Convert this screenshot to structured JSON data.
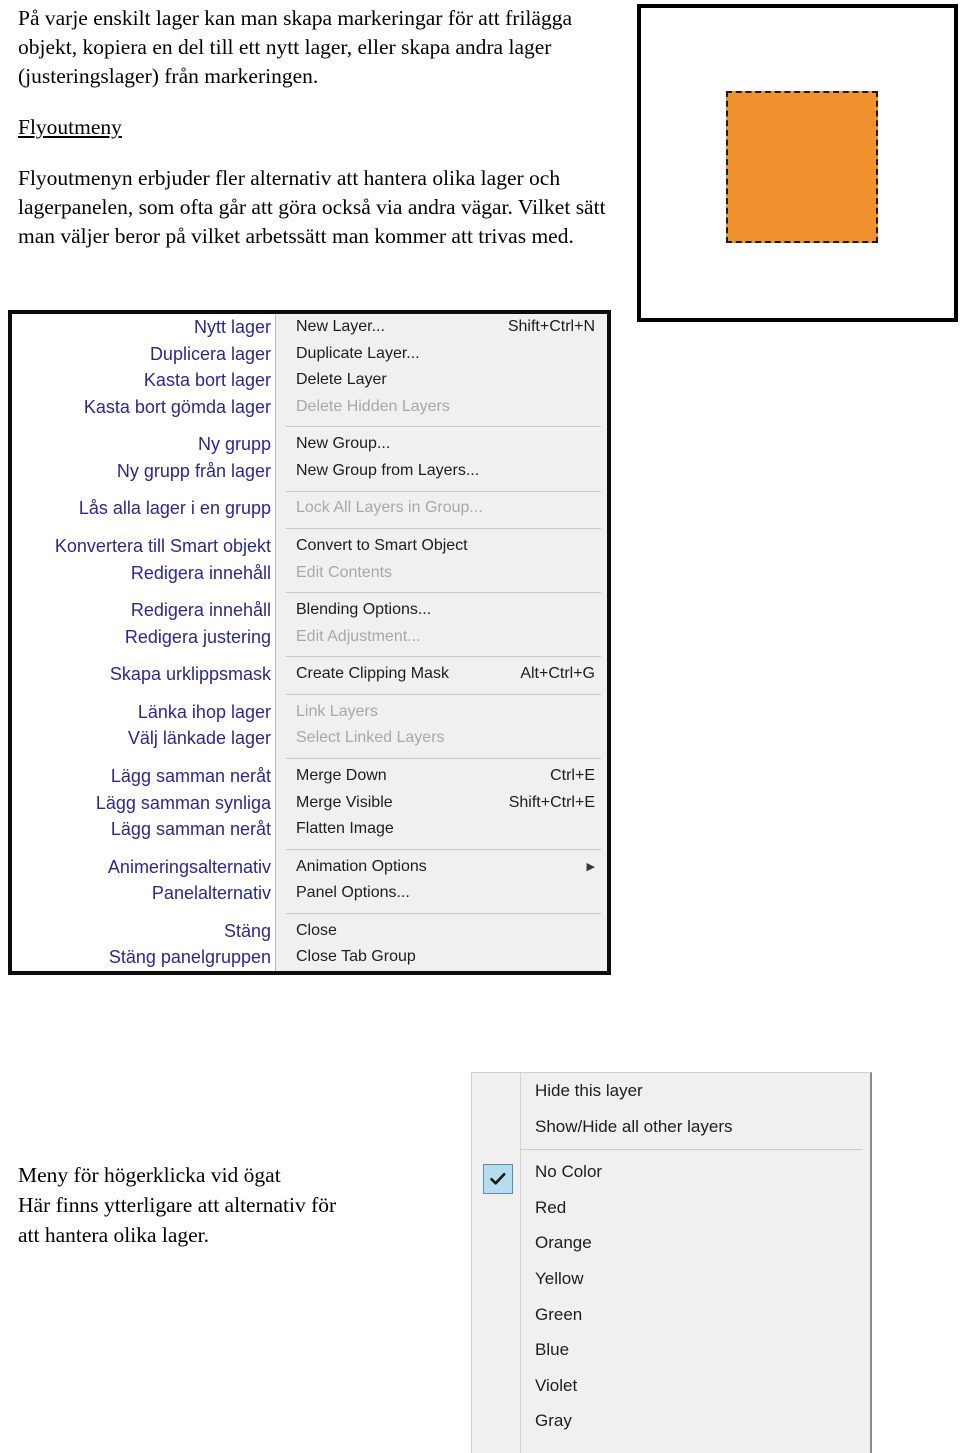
{
  "intro": {
    "paragraph1": "På varje enskilt lager kan man skapa markeringar för att frilägga objekt, kopiera en del till ett nytt lager, eller skapa andra lager (justeringslager) från markeringen.",
    "heading": "Flyoutmeny",
    "paragraph2": "Flyoutmenyn erbjuder fler alternativ att hantera olika lager och lagerpanelen, som ofta går att göra också via andra vägar. Vilket sätt man väljer beror på vilket arbetssätt man kommer att trivas med."
  },
  "illustration": {
    "selection_color": "#F0912D",
    "border_style": "dashed",
    "border_color": "#1a1a1a"
  },
  "flyout_menu": {
    "swedish_column_color": "#2a2a8c",
    "english_column_bg": "#f0f0f0",
    "groups": [
      {
        "items": [
          {
            "sv": "Nytt lager",
            "en": "New Layer...",
            "shortcut": "Shift+Ctrl+N",
            "disabled": false
          },
          {
            "sv": "Duplicera lager",
            "en": "Duplicate Layer...",
            "shortcut": "",
            "disabled": false
          },
          {
            "sv": "Kasta bort lager",
            "en": "Delete Layer",
            "shortcut": "",
            "disabled": false
          },
          {
            "sv": "Kasta bort gömda lager",
            "en": "Delete Hidden Layers",
            "shortcut": "",
            "disabled": true
          }
        ]
      },
      {
        "items": [
          {
            "sv": "Ny grupp",
            "en": "New Group...",
            "shortcut": "",
            "disabled": false
          },
          {
            "sv": "Ny grupp från lager",
            "en": "New Group from Layers...",
            "shortcut": "",
            "disabled": false
          }
        ]
      },
      {
        "items": [
          {
            "sv": "Lås alla lager i en grupp",
            "en": "Lock All Layers in Group...",
            "shortcut": "",
            "disabled": true
          }
        ]
      },
      {
        "items": [
          {
            "sv": "Konvertera till Smart objekt",
            "en": "Convert to Smart Object",
            "shortcut": "",
            "disabled": false
          },
          {
            "sv": "Redigera innehåll",
            "en": "Edit Contents",
            "shortcut": "",
            "disabled": true
          }
        ]
      },
      {
        "items": [
          {
            "sv": "Redigera innehåll",
            "en": "Blending Options...",
            "shortcut": "",
            "disabled": false
          },
          {
            "sv": "Redigera justering",
            "en": "Edit Adjustment...",
            "shortcut": "",
            "disabled": true
          }
        ]
      },
      {
        "items": [
          {
            "sv": "Skapa urklippsmask",
            "en": "Create Clipping Mask",
            "shortcut": "Alt+Ctrl+G",
            "disabled": false
          }
        ]
      },
      {
        "items": [
          {
            "sv": "Länka ihop lager",
            "en": "Link Layers",
            "shortcut": "",
            "disabled": true
          },
          {
            "sv": "Välj länkade lager",
            "en": "Select Linked Layers",
            "shortcut": "",
            "disabled": true
          }
        ]
      },
      {
        "items": [
          {
            "sv": "Lägg samman neråt",
            "en": "Merge Down",
            "shortcut": "Ctrl+E",
            "disabled": false
          },
          {
            "sv": "Lägg samman synliga",
            "en": "Merge Visible",
            "shortcut": "Shift+Ctrl+E",
            "disabled": false
          },
          {
            "sv": "Lägg samman neråt",
            "en": "Flatten Image",
            "shortcut": "",
            "disabled": false
          }
        ]
      },
      {
        "items": [
          {
            "sv": "Animeringsalternativ",
            "en": "Animation Options",
            "shortcut": "",
            "submenu": true,
            "disabled": false
          },
          {
            "sv": "Panelalternativ",
            "en": "Panel Options...",
            "shortcut": "",
            "disabled": false
          }
        ]
      },
      {
        "items": [
          {
            "sv": "Stäng",
            "en": "Close",
            "shortcut": "",
            "disabled": false
          },
          {
            "sv": "Stäng panelgruppen",
            "en": "Close Tab Group",
            "shortcut": "",
            "disabled": false
          }
        ]
      }
    ]
  },
  "eye_context_menu": {
    "checked_item": "No Color",
    "check_fill": "#b7dcef",
    "check_border": "#5a8faa",
    "groups": [
      {
        "items": [
          {
            "label": "Hide this layer"
          },
          {
            "label": "Show/Hide all other layers"
          }
        ]
      },
      {
        "items": [
          {
            "label": "No Color"
          },
          {
            "label": "Red"
          },
          {
            "label": "Orange"
          },
          {
            "label": "Yellow"
          },
          {
            "label": "Green"
          },
          {
            "label": "Blue"
          },
          {
            "label": "Violet"
          },
          {
            "label": "Gray"
          }
        ]
      }
    ]
  },
  "bottom_caption": {
    "line1": "Meny för högerklicka vid ögat",
    "line2": "Här finns ytterligare att alternativ för",
    "line3": "att hantera olika lager."
  }
}
